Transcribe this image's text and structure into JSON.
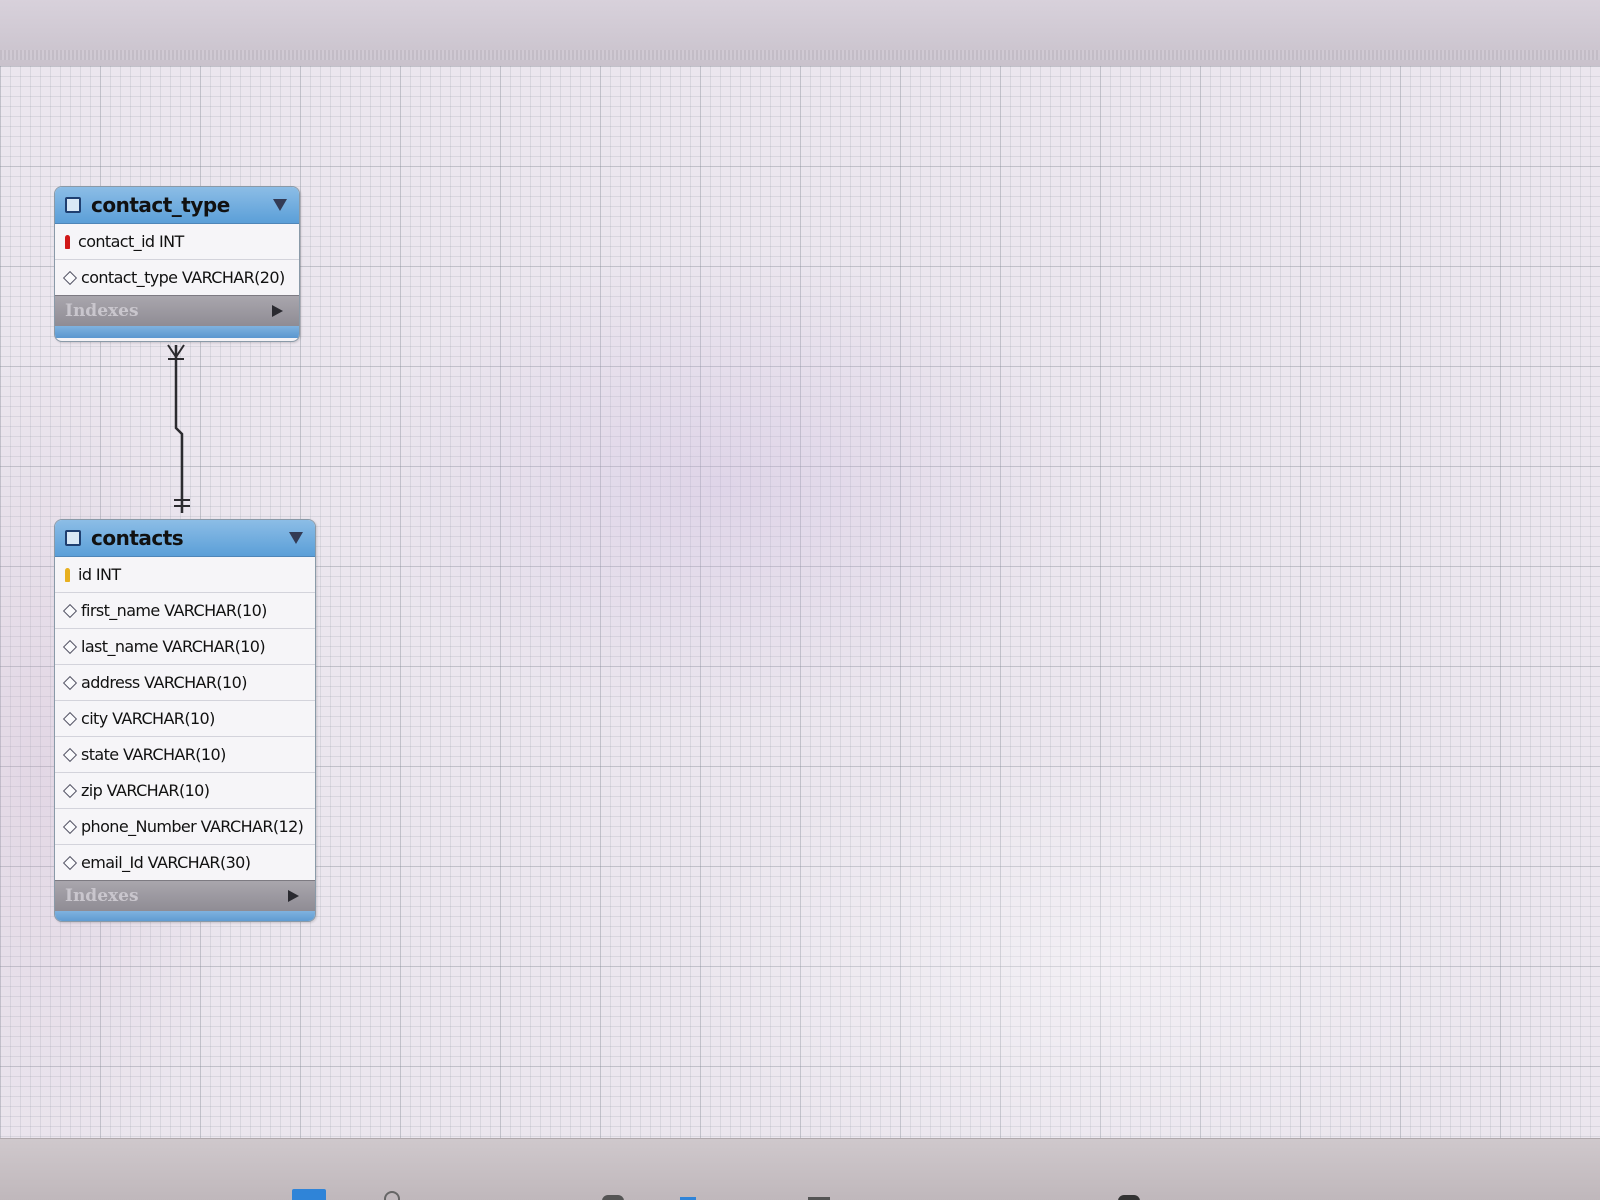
{
  "diagram": {
    "tables": [
      {
        "name": "contact_type",
        "columns": [
          {
            "label": "contact_id INT",
            "key": "primary"
          },
          {
            "label": "contact_type VARCHAR(20)",
            "key": "none"
          }
        ],
        "indexes_label": "Indexes"
      },
      {
        "name": "contacts",
        "columns": [
          {
            "label": "id INT",
            "key": "primary"
          },
          {
            "label": "first_name VARCHAR(10)",
            "key": "none"
          },
          {
            "label": "last_name VARCHAR(10)",
            "key": "none"
          },
          {
            "label": "address VARCHAR(10)",
            "key": "none"
          },
          {
            "label": "city VARCHAR(10)",
            "key": "none"
          },
          {
            "label": "state VARCHAR(10)",
            "key": "none"
          },
          {
            "label": "zip VARCHAR(10)",
            "key": "none"
          },
          {
            "label": "phone_Number VARCHAR(12)",
            "key": "none"
          },
          {
            "label": "email_Id VARCHAR(30)",
            "key": "none"
          }
        ],
        "indexes_label": "Indexes"
      }
    ],
    "relationship": {
      "from": "contacts",
      "to": "contact_type",
      "from_end": "one",
      "to_end": "many"
    },
    "colors": {
      "table_header": "#5b9fd8",
      "primary_key_fk": "#d01818",
      "primary_key": "#e8b020",
      "indexes_bar": "#8f8c94"
    }
  }
}
